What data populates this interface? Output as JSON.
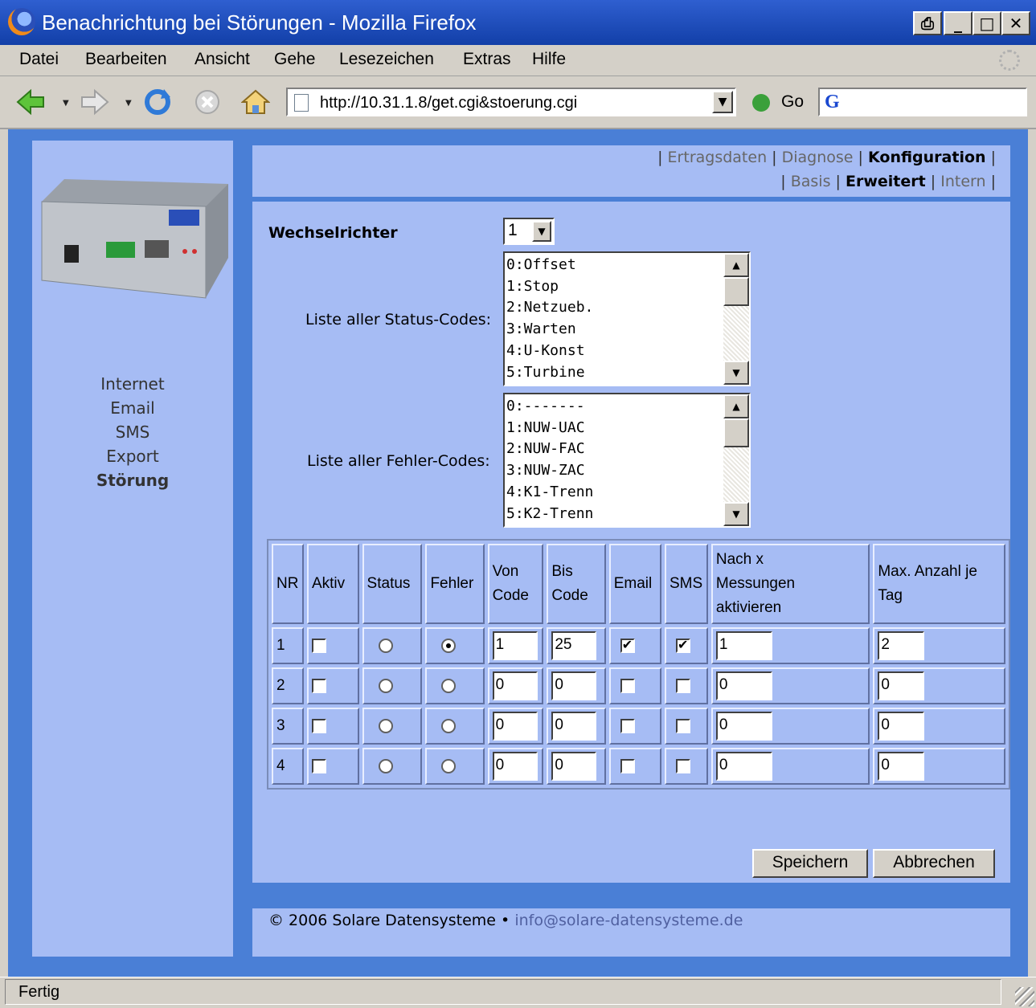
{
  "window": {
    "title": "Benachrichtung bei Störungen - Mozilla Firefox"
  },
  "menu": [
    "Datei",
    "Bearbeiten",
    "Ansicht",
    "Gehe",
    "Lesezeichen",
    "Extras",
    "Hilfe"
  ],
  "toolbar": {
    "url": "http://10.31.1.8/get.cgi&stoerung.cgi",
    "go_label": "Go"
  },
  "sidebar": {
    "items": [
      {
        "label": "Internet"
      },
      {
        "label": "Email"
      },
      {
        "label": "SMS"
      },
      {
        "label": "Export"
      },
      {
        "label": "Störung"
      }
    ]
  },
  "topnav": {
    "row1": {
      "sep": "|",
      "ertragsdaten": "Ertragsdaten",
      "diagnose": "Diagnose",
      "konfiguration": "Konfiguration"
    },
    "row2": {
      "basis": "Basis",
      "erweitert": "Erweitert",
      "intern": "Intern"
    }
  },
  "form": {
    "wechselrichter_label": "Wechselrichter",
    "wechselrichter_value": "1",
    "status_label": "Liste aller Status-Codes:",
    "status_codes": [
      "0:Offset",
      "1:Stop",
      "2:Netzueb.",
      "3:Warten",
      "4:U-Konst",
      "5:Turbine"
    ],
    "fehler_label": "Liste aller Fehler-Codes:",
    "fehler_codes": [
      "0:-------",
      "1:NUW-UAC",
      "2:NUW-FAC",
      "3:NUW-ZAC",
      "4:K1-Trenn",
      "5:K2-Trenn"
    ]
  },
  "table": {
    "headers": {
      "nr": "NR",
      "aktiv": "Aktiv",
      "status": "Status",
      "fehler": "Fehler",
      "von1": "Von",
      "von2": "Code",
      "bis1": "Bis",
      "bis2": "Code",
      "email": "Email",
      "sms": "SMS",
      "nach1": "Nach x",
      "nach2": "Messungen",
      "nach3": "aktivieren",
      "max1": "Max. Anzahl je",
      "max2": "Tag"
    },
    "rows": [
      {
        "nr": "1",
        "aktiv": false,
        "mode": "fehler",
        "von": "1",
        "bis": "25",
        "email": true,
        "sms": true,
        "nach": "1",
        "max": "2"
      },
      {
        "nr": "2",
        "aktiv": false,
        "mode": "none",
        "von": "0",
        "bis": "0",
        "email": false,
        "sms": false,
        "nach": "0",
        "max": "0"
      },
      {
        "nr": "3",
        "aktiv": false,
        "mode": "none",
        "von": "0",
        "bis": "0",
        "email": false,
        "sms": false,
        "nach": "0",
        "max": "0"
      },
      {
        "nr": "4",
        "aktiv": false,
        "mode": "none",
        "von": "0",
        "bis": "0",
        "email": false,
        "sms": false,
        "nach": "0",
        "max": "0"
      }
    ]
  },
  "buttons": {
    "save": "Speichern",
    "cancel": "Abbrechen"
  },
  "footer": {
    "copyright": "© 2006 Solare Datensysteme",
    "bullet": "•",
    "email": "info@solare-datensysteme.de"
  },
  "status": {
    "text": "Fertig"
  }
}
